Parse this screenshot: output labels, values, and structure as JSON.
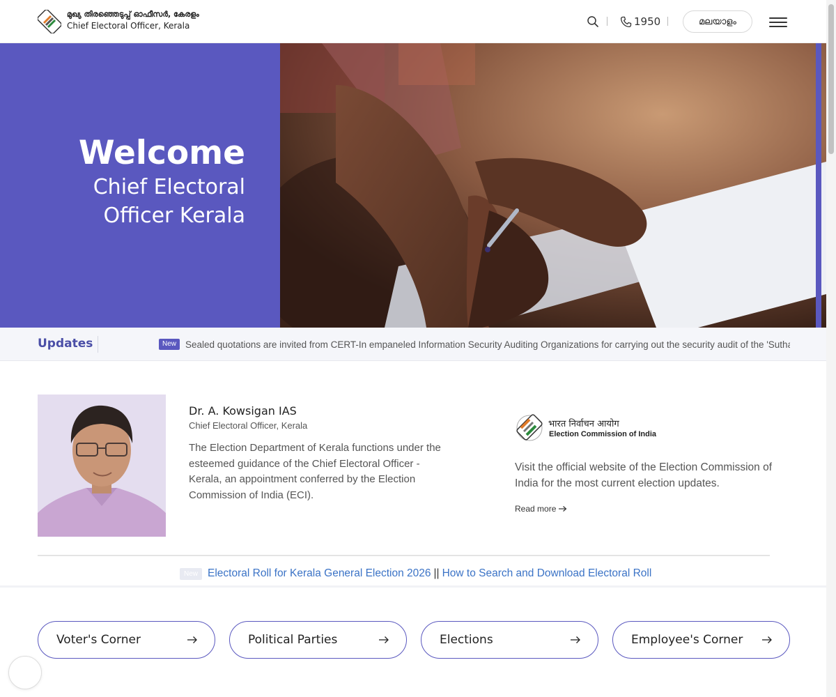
{
  "header": {
    "brand_ml": "മുഖ്യ തിരഞ്ഞെടുപ്പ് ഓഫീസർ, കേരളം",
    "brand_en": "Chief Electoral Officer, Kerala",
    "phone": "1950",
    "language_button": "മലയാളം",
    "icons": [
      "search-icon",
      "phone-icon",
      "hamburger-menu-icon"
    ]
  },
  "hero": {
    "welcome": "Welcome",
    "line1": "Chief Electoral",
    "line2": "Officer Kerala"
  },
  "updates": {
    "title": "Updates",
    "badge": "New",
    "ticker": "Sealed quotations are invited from CERT-In empaneled Information Security Auditing Organizations for carrying out the security audit of the 'Sutharya"
  },
  "officer": {
    "name": "Dr. A. Kowsigan IAS",
    "title": "Chief Electoral Officer, Kerala",
    "description": "The Election Department of Kerala functions under the esteemed guidance of the Chief Electoral Officer - Kerala, an appointment conferred by the Election Commission of India (ECI)."
  },
  "eci": {
    "hindi": "भारत निर्वाचन आयोग",
    "english": "Election Commission of India",
    "description": "Visit the official website of the Election Commission of India for the most current election updates.",
    "read_more": "Read more"
  },
  "notice": {
    "badge": "New",
    "link1": "Electoral Roll for Kerala General Election 2026",
    "separator": "||",
    "link2": "How to Search and Download Electoral Roll"
  },
  "categories": [
    {
      "label": "Voter's Corner"
    },
    {
      "label": "Political Parties"
    },
    {
      "label": "Elections"
    },
    {
      "label": "Employee's Corner"
    }
  ],
  "colors": {
    "brand": "#5a58bf",
    "link": "#3b73c6",
    "updates_title": "#4b4fa7"
  }
}
